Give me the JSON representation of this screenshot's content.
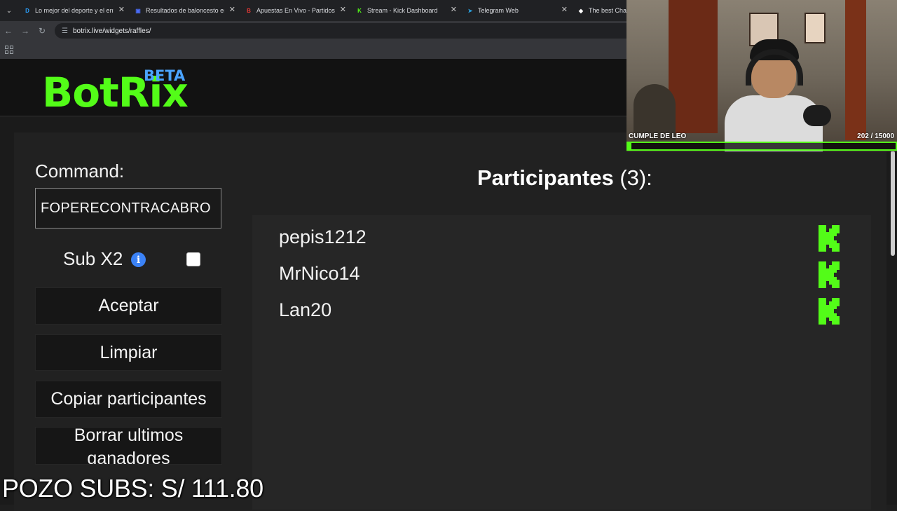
{
  "browser": {
    "tabs": [
      {
        "title": "Lo mejor del deporte y el entretenimiento",
        "icon": "d-icon",
        "color": "#2aa1ff",
        "glyph": "D"
      },
      {
        "title": "Resultados de baloncesto en directo",
        "icon": "flashscore-icon",
        "color": "#4a6cf7",
        "glyph": "▣"
      },
      {
        "title": "Apuestas En Vivo - Partidos de hoy",
        "icon": "betting-icon",
        "color": "#e53935",
        "glyph": "B"
      },
      {
        "title": "Stream - Kick Dashboard",
        "icon": "kick-icon",
        "color": "#53fc18",
        "glyph": "K"
      },
      {
        "title": "Telegram Web",
        "icon": "telegram-icon",
        "color": "#2aa1df",
        "glyph": "➤"
      },
      {
        "title": "The best ChatBot",
        "icon": "botrix-icon",
        "color": "#ffffff",
        "glyph": "◆"
      }
    ],
    "url": "botrix.live/widgets/raffles/"
  },
  "header": {
    "logo": "BotRix",
    "badge": "BETA"
  },
  "form": {
    "command_label": "Command:",
    "command_value": "FOPERECONTRACABRO",
    "sub_label": "Sub X2",
    "sub_checked": false,
    "buttons": {
      "accept": "Aceptar",
      "clear": "Limpiar",
      "copy": "Copiar participantes",
      "delete_winners": "Borrar ultimos ganadores"
    }
  },
  "participants": {
    "title": "Participantes",
    "count_text": "(3):",
    "list": [
      {
        "name": "pepis1212",
        "platform": "kick-icon"
      },
      {
        "name": "MrNico14",
        "platform": "kick-icon"
      },
      {
        "name": "Lan20",
        "platform": "kick-icon"
      }
    ]
  },
  "overlay": {
    "goal_label": "CUMPLE DE LEO",
    "goal_count": "202 / 15000",
    "goal_progress": 0.0135,
    "pozo_text": "POZO SUBS: S/ 111.80"
  },
  "colors": {
    "kick_green": "#53fc18",
    "beta_blue": "#4aa3ff"
  }
}
